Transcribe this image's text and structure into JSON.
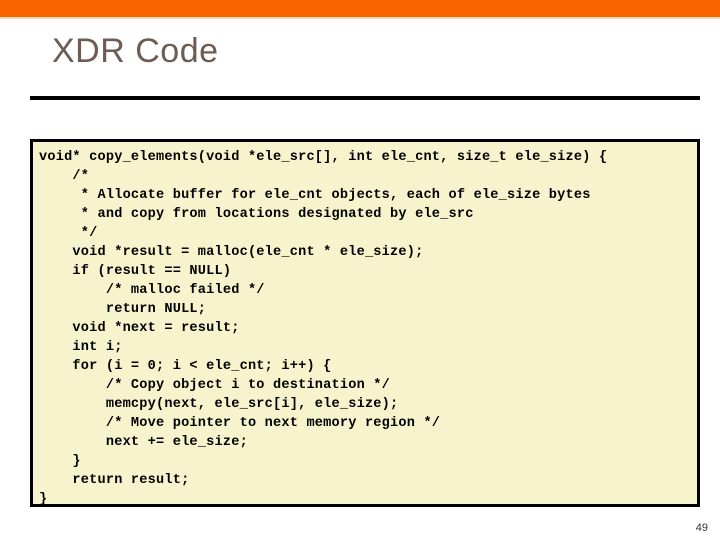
{
  "slide": {
    "title": "XDR Code",
    "page_number": "49",
    "accent_color": "#fa6400",
    "title_color": "#6e5c52",
    "code_background_color": "#f7f4cd",
    "code_border_color": "#000000"
  },
  "code_block": {
    "language": "c",
    "lines": [
      "void* copy_elements(void *ele_src[], int ele_cnt, size_t ele_size) {",
      "    /*",
      "     * Allocate buffer for ele_cnt objects, each of ele_size bytes",
      "     * and copy from locations designated by ele_src",
      "     */",
      "    void *result = malloc(ele_cnt * ele_size);",
      "    if (result == NULL)",
      "        /* malloc failed */",
      "        return NULL;",
      "    void *next = result;",
      "    int i;",
      "    for (i = 0; i < ele_cnt; i++) {",
      "        /* Copy object i to destination */",
      "        memcpy(next, ele_src[i], ele_size);",
      "        /* Move pointer to next memory region */",
      "        next += ele_size;",
      "    }",
      "    return result;",
      "}"
    ],
    "text": "void* copy_elements(void *ele_src[], int ele_cnt, size_t ele_size) {\n    /*\n     * Allocate buffer for ele_cnt objects, each of ele_size bytes\n     * and copy from locations designated by ele_src\n     */\n    void *result = malloc(ele_cnt * ele_size);\n    if (result == NULL)\n        /* malloc failed */\n        return NULL;\n    void *next = result;\n    int i;\n    for (i = 0; i < ele_cnt; i++) {\n        /* Copy object i to destination */\n        memcpy(next, ele_src[i], ele_size);\n        /* Move pointer to next memory region */\n        next += ele_size;\n    }\n    return result;\n}"
  }
}
